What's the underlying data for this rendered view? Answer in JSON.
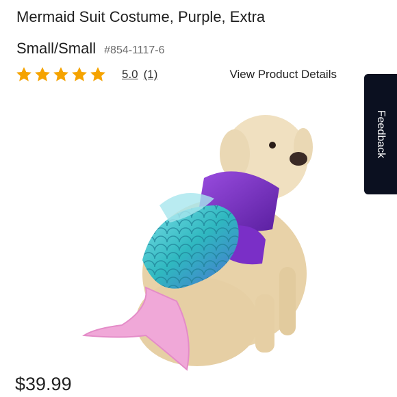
{
  "product": {
    "title": "Mermaid Suit Costume, Purple, Extra Small/Small",
    "sku": "#854-1117-6",
    "rating_value": "5.0",
    "rating_count": "(1)",
    "stars_filled": 5,
    "view_details_label": "View Product Details",
    "price": "$39.99"
  },
  "feedback_tab": {
    "label": "Feedback"
  },
  "icons": [
    "star-icon"
  ],
  "colors": {
    "star": "#f5a300",
    "feedback_bg": "#0b1020",
    "costume_purple": "#7a2fc7",
    "tail_pink": "#f0a8d8",
    "scales_teal": "#2fc4c0"
  }
}
